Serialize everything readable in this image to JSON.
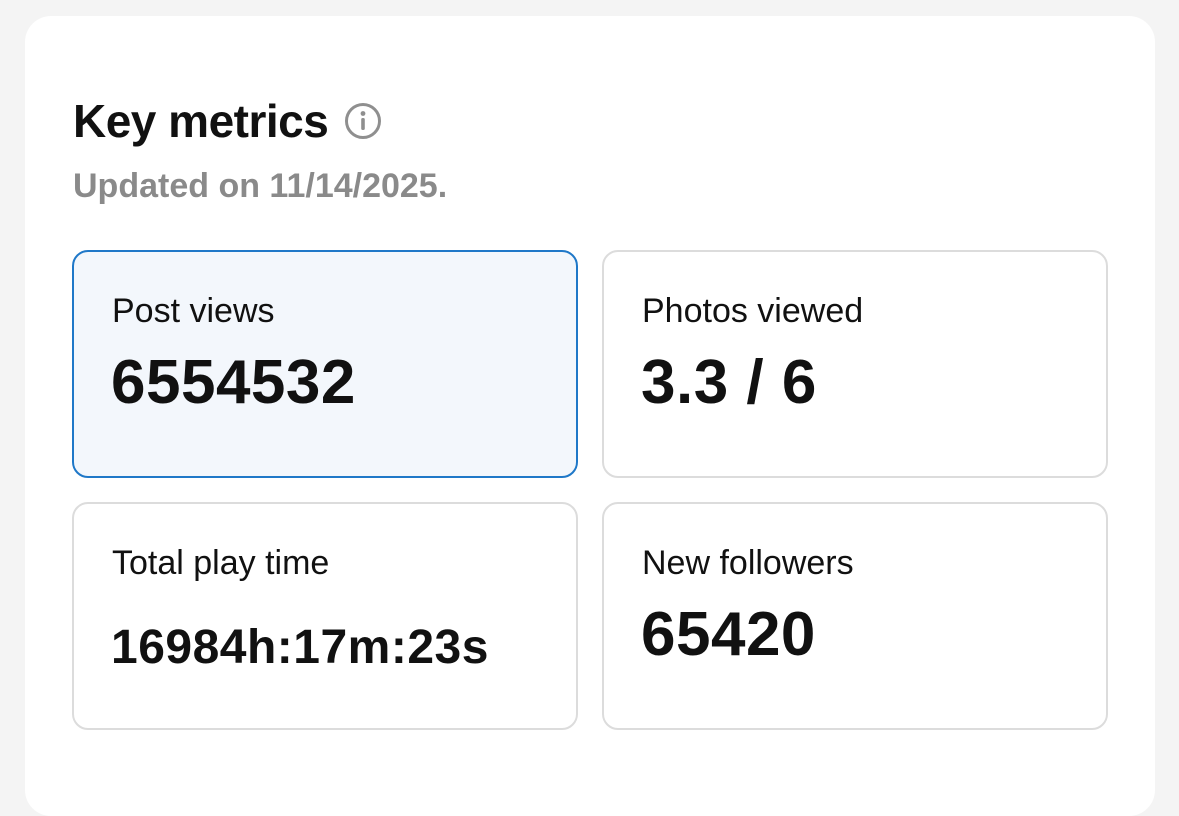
{
  "key_metrics": {
    "title": "Key metrics",
    "info_icon": "info-circle-icon",
    "updated_text": "Updated on 11/14/2025.",
    "accent_color": "#1f78c8",
    "selected_tile_background": "#f3f7fc",
    "tiles": [
      {
        "label": "Post views",
        "value": "6554532",
        "selected": true
      },
      {
        "label": "Photos viewed",
        "value": "3.3 / 6",
        "selected": false
      },
      {
        "label": "Total play time",
        "value": "16984h:17m:23s",
        "selected": false
      },
      {
        "label": "New followers",
        "value": "65420",
        "selected": false
      }
    ]
  }
}
